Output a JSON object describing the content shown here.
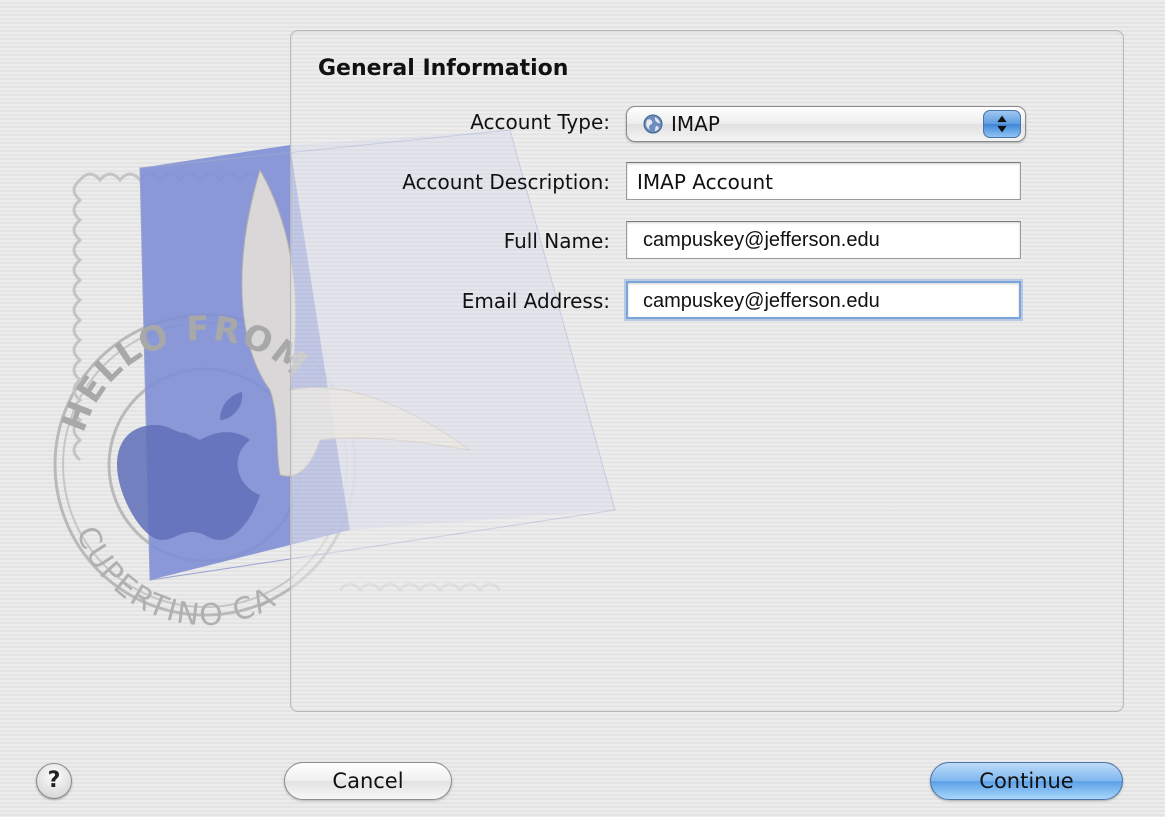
{
  "section_title": "General Information",
  "labels": {
    "account_type": "Account Type:",
    "account_description": "Account Description:",
    "full_name": "Full Name:",
    "email_address": "Email Address:"
  },
  "fields": {
    "account_type": "IMAP",
    "account_description": "IMAP Account",
    "full_name": "campuskey@jefferson.edu",
    "email_address": "campuskey@jefferson.edu"
  },
  "stamp_text": {
    "top": "HELLO FROM",
    "bottom": "CUPERTINO CA"
  },
  "buttons": {
    "help": "?",
    "cancel": "Cancel",
    "continue": "Continue"
  },
  "icons": {
    "account_type": "globe-icon",
    "popup_arrows": "up-down-arrows-icon",
    "stamp": "mail-stamp-illustration"
  },
  "colors": {
    "default_button": "#6aaaf0",
    "focus_ring": "#7ba4d8",
    "stamp_blue": "#7f8fd6"
  }
}
